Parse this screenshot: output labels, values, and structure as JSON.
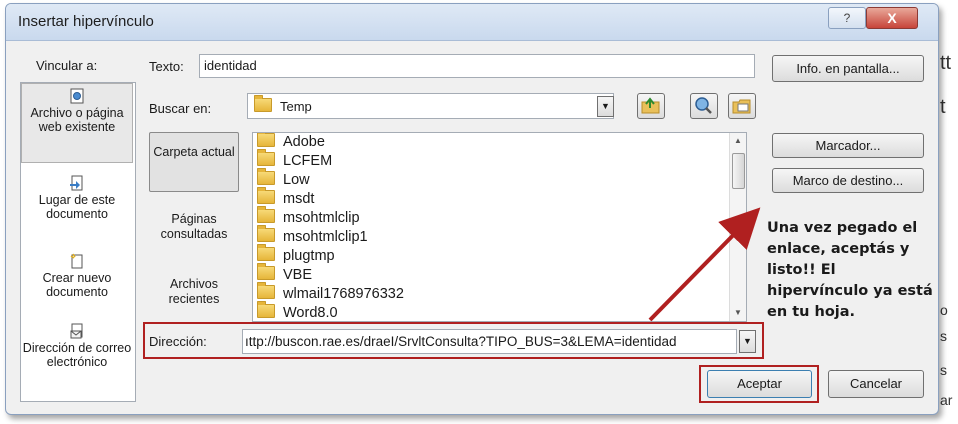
{
  "background": {
    "fragments": [
      "tt",
      "t",
      "o",
      "s",
      "s",
      "ar"
    ]
  },
  "dialog": {
    "title": "Insertar hipervínculo",
    "help_glyph": "?",
    "close_glyph": "X"
  },
  "link_to": {
    "label": "Vincular a:",
    "items": [
      {
        "label": "Archivo o página web existente",
        "icon": "web-page-icon",
        "selected": true
      },
      {
        "label": "Lugar de este documento",
        "icon": "document-place-icon",
        "selected": false
      },
      {
        "label": "Crear nuevo documento",
        "icon": "new-document-icon",
        "selected": false
      },
      {
        "label": "Dirección de correo electrónico",
        "icon": "email-icon",
        "selected": false
      }
    ]
  },
  "text_field": {
    "label": "Texto:",
    "value": "identidad"
  },
  "screen_tip_button": "Info. en pantalla...",
  "look_in": {
    "label": "Buscar en:",
    "value": "Temp"
  },
  "places": [
    {
      "label": "Carpeta actual",
      "selected": true
    },
    {
      "label": "Páginas consultadas",
      "selected": false
    },
    {
      "label": "Archivos recientes",
      "selected": false
    }
  ],
  "files": [
    "Adobe",
    "LCFEM",
    "Low",
    "msdt",
    "msohtmlclip",
    "msohtmlclip1",
    "plugtmp",
    "VBE",
    "wlmail1768976332",
    "Word8.0"
  ],
  "bookmark_button": "Marcador...",
  "target_frame_button": "Marco de destino...",
  "address": {
    "label": "Dirección:",
    "value": "ıttp://buscon.rae.es/draeI/SrvltConsulta?TIPO_BUS=3&LEMA=identidad"
  },
  "annotation": "Una vez pegado el enlace, aceptás y listo!! El hipervínculo ya está en tu hoja.",
  "ok_button": "Aceptar",
  "cancel_button": "Cancelar",
  "colors": {
    "highlight": "#b02020",
    "arrow": "#b02020"
  }
}
